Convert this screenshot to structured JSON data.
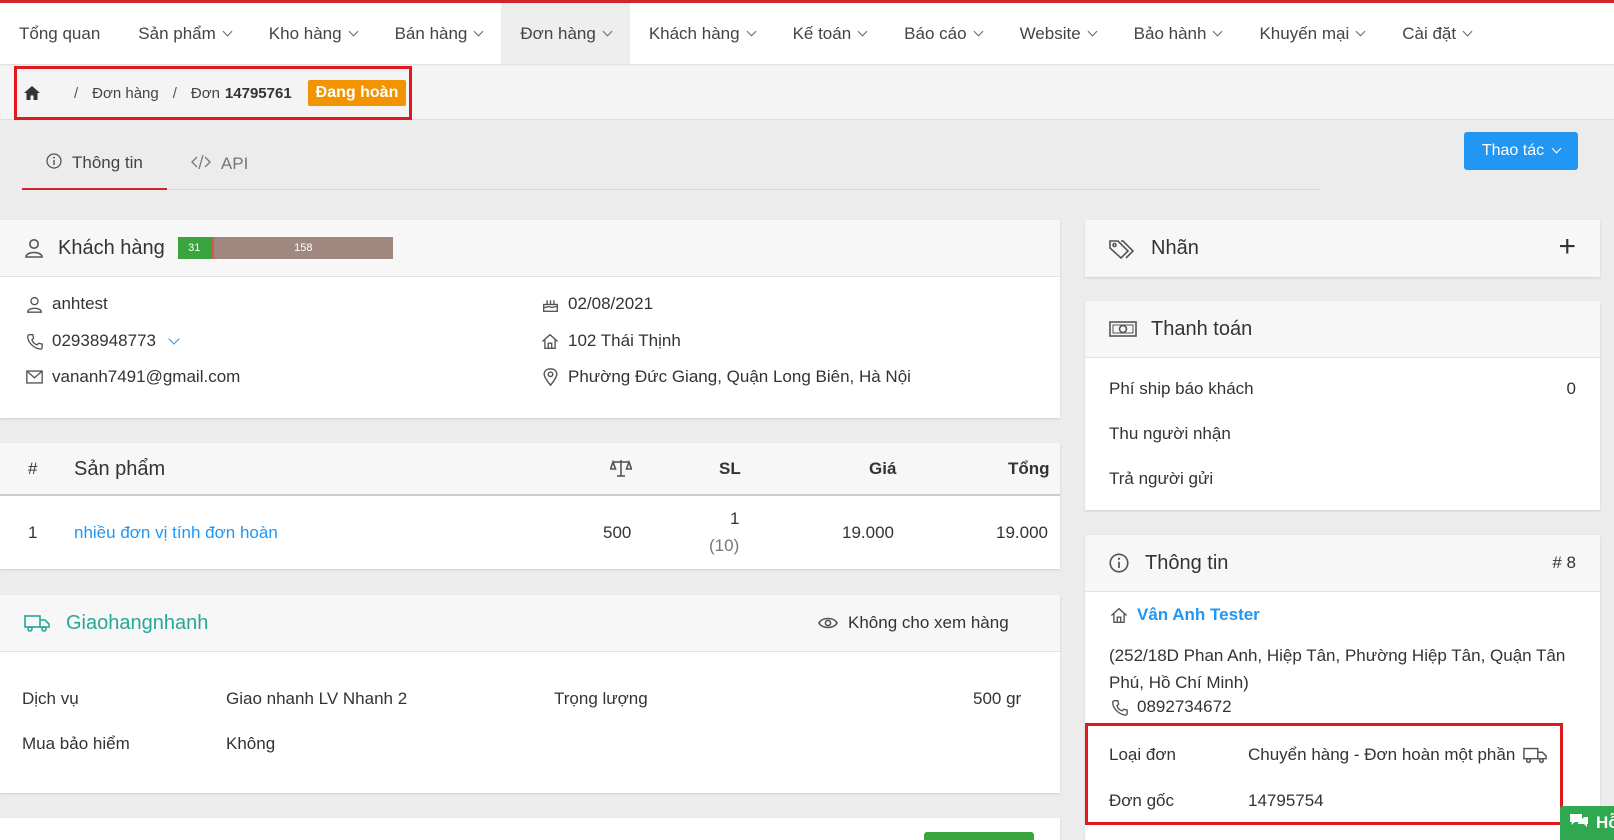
{
  "nav": {
    "items": [
      {
        "label": "Tổng quan",
        "caret": false
      },
      {
        "label": "Sản phẩm",
        "caret": true
      },
      {
        "label": "Kho hàng",
        "caret": true
      },
      {
        "label": "Bán hàng",
        "caret": true
      },
      {
        "label": "Đơn hàng",
        "caret": true
      },
      {
        "label": "Khách hàng",
        "caret": true
      },
      {
        "label": "Kế toán",
        "caret": true
      },
      {
        "label": "Báo cáo",
        "caret": true
      },
      {
        "label": "Website",
        "caret": true
      },
      {
        "label": "Bảo hành",
        "caret": true
      },
      {
        "label": "Khuyến mại",
        "caret": true
      },
      {
        "label": "Cài đặt",
        "caret": true
      }
    ],
    "active_index": 4
  },
  "breadcrumb": {
    "section": "Đơn hàng",
    "order_prefix": "Đơn",
    "order_number": "14795761",
    "status_badge": "Đang hoàn"
  },
  "tabs": [
    {
      "label": "Thông tin",
      "icon": "info-icon"
    },
    {
      "label": "API",
      "icon": "code-icon"
    }
  ],
  "actions": {
    "button_label": "Thao tác"
  },
  "customer": {
    "title": "Khách hàng",
    "bar_success": "31",
    "bar_total": "158",
    "name": "anhtest",
    "phone": "02938948773",
    "email": "vananh7491@gmail.com",
    "birthday": "02/08/2021",
    "address": "102 Thái Thịnh",
    "location": "Phường Đức Giang, Quận Long Biên, Hà Nội"
  },
  "products": {
    "headers": {
      "index": "#",
      "product": "Sản phẩm",
      "qty": "SL",
      "price": "Giá",
      "total": "Tổng"
    },
    "rows": [
      {
        "index": "1",
        "name": "nhiều đơn vị tính đơn hoàn",
        "weight": "500",
        "qty": "1",
        "qty_sub": "(10)",
        "price": "19.000",
        "total": "19.000"
      }
    ]
  },
  "shipping": {
    "carrier": "Giaohangnhanh",
    "view_policy": "Không cho xem hàng",
    "service_label": "Dịch vụ",
    "service_value": "Giao nhanh LV Nhanh 2",
    "weight_label": "Trọng lượng",
    "weight_value": "500 gr",
    "insurance_label": "Mua bảo hiểm",
    "insurance_value": "Không"
  },
  "tags": {
    "title": "Nhãn"
  },
  "payment": {
    "title": "Thanh toán",
    "ship_fee_label": "Phí ship báo khách",
    "ship_fee_value": "0",
    "collect_label": "Thu người nhận",
    "return_label": "Trả người gửi"
  },
  "info": {
    "title": "Thông tin",
    "number": "# 8",
    "shop_name": "Vân Anh Tester",
    "shop_address": "(252/18D Phan Anh, Hiệp Tân, Phường Hiệp Tân, Quận Tân Phú, Hồ Chí Minh)",
    "shop_phone": "0892734672",
    "type_label": "Loại đơn",
    "type_value": "Chuyển hàng - Đơn hoàn một phần",
    "origin_label": "Đơn gốc",
    "origin_value": "14795754"
  },
  "chat": {
    "label": "Hỗ"
  },
  "colors": {
    "accent": "#d0262a",
    "primary": "#2196f3",
    "badge": "#f29400",
    "success": "#3aa53e",
    "carrier": "#26a69a"
  }
}
